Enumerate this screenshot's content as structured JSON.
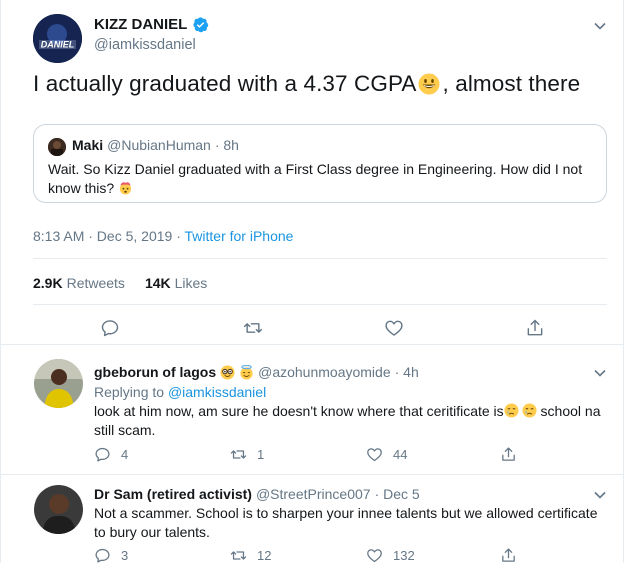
{
  "tweet": {
    "author_name": "KIZZ DANIEL",
    "author_handle": "@iamkissdaniel",
    "avatar_text": "DANIEL",
    "text_before": "I actually graduated with a 4.37 CGPA",
    "text_after": ", almost there",
    "timestamp": "8:13 AM · Dec 5, 2019 · ",
    "source": "Twitter for iPhone",
    "retweets_count": "2.9K",
    "retweets_label": "Retweets",
    "likes_count": "14K",
    "likes_label": "Likes"
  },
  "quote": {
    "name": "Maki",
    "handle": "@NubianHuman",
    "time": "· 8h",
    "text": "Wait. So Kizz Daniel graduated with a First Class degree in Engineering. How did I not know this?"
  },
  "replies": [
    {
      "name": "gbeborun of lagos",
      "handle": "@azohunmoayomide",
      "time": "· 4h",
      "replying_prefix": "Replying to",
      "replying_to": "@iamkissdaniel",
      "text_a": "look at him now, am sure he doesn't know where that ceritificate is",
      "text_b": " school na still scam.",
      "replies": "4",
      "retweets": "1",
      "likes": "44"
    },
    {
      "name": "Dr Sam (retired activist)",
      "handle": "@StreetPrince007",
      "time": "· Dec 5",
      "text": "Not a scammer. School is to sharpen your innee talents but we allowed certificate to bury our talents.",
      "replies": "3",
      "retweets": "12",
      "likes": "132"
    }
  ],
  "colors": {
    "link": "#1b95e0",
    "muted": "#657786",
    "text": "#14171a",
    "border": "#e6ecf0"
  }
}
